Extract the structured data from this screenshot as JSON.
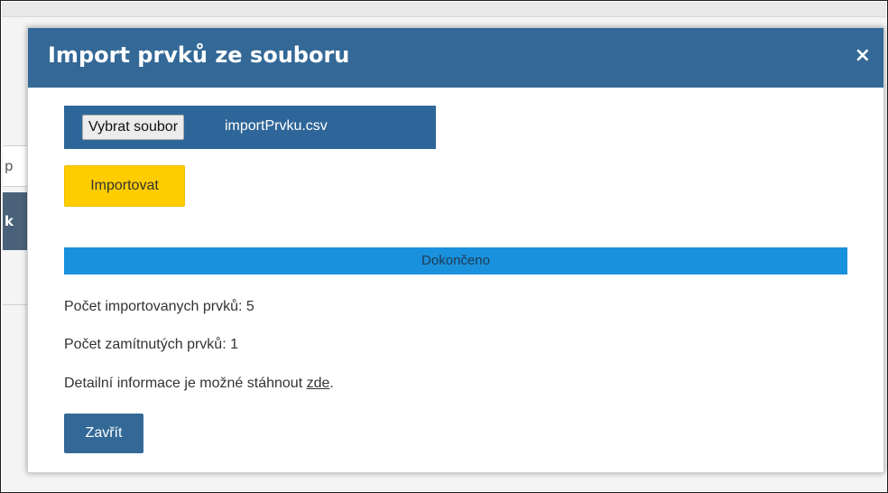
{
  "background": {
    "fragment_1": "p",
    "fragment_2": "k"
  },
  "dialog": {
    "title": "Import prvků ze souboru",
    "close_icon": "×",
    "file_input": {
      "button_label": "Vybrat soubor",
      "file_name": "importPrvku.csv"
    },
    "import_button": "Importovat",
    "progress": {
      "label": "Dokončeno",
      "percent": 100
    },
    "imported_label": "Počet importovanych prvků:",
    "imported_count": "5",
    "rejected_label": "Počet zamítnutých prvků:",
    "rejected_count": "1",
    "details_text": "Detailní informace je možné stáhnout",
    "details_link": "zde",
    "details_suffix": ".",
    "close_button": "Zavřít"
  },
  "colors": {
    "header": "#346997",
    "file_bar": "#2f6699",
    "import_button": "#ffcc00",
    "progress": "#1a8cd6",
    "close_button": "#346997"
  }
}
